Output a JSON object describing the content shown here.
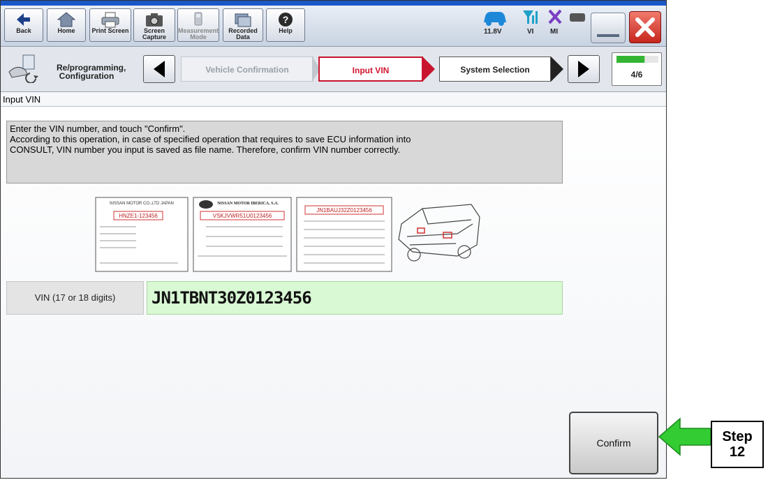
{
  "toolbar": {
    "buttons": [
      {
        "label": "Back",
        "icon": "back-arrow-icon"
      },
      {
        "label": "Home",
        "icon": "home-icon"
      },
      {
        "label": "Print Screen",
        "icon": "printer-icon"
      },
      {
        "label": "Screen Capture",
        "icon": "camera-icon"
      },
      {
        "label": "Measurement Mode",
        "icon": "meter-icon"
      },
      {
        "label": "Recorded Data",
        "icon": "recorded-data-icon"
      },
      {
        "label": "Help",
        "icon": "help-icon"
      }
    ],
    "status": {
      "voltage": "11.8V",
      "vi": "VI",
      "mi": "MI"
    }
  },
  "nav": {
    "section": "Re/programming, Configuration",
    "steps": [
      "Vehicle Confirmation",
      "Input VIN",
      "System Selection"
    ],
    "active_step": "Input VIN",
    "progress": "4/6",
    "progress_fraction": 0.67
  },
  "page_title": "Input VIN",
  "instructions": [
    "Enter the VIN number, and touch \"Confirm\".",
    "According to this operation, in case of specified operation that requires to save ECU information into",
    "CONSULT, VIN number you input is saved as file name. Therefore, confirm VIN number correctly."
  ],
  "plates": {
    "p1_header": "NISSAN MOTOR CO.,LTD JAPAN",
    "p1_vin": "HNZE1-123456",
    "p2_header": "NISSAN MOTOR IBERICA, S.A.",
    "p2_vin": "VSKJVWR51U0123456",
    "p3_vin": "JN1BAUJ32Z0123456"
  },
  "vin": {
    "label": "VIN (17 or 18 digits)",
    "value": "JN1TBNT30Z0123456"
  },
  "confirm_label": "Confirm",
  "callout": {
    "step": "Step",
    "number": "12"
  },
  "colors": {
    "accent_green": "#33cc33",
    "active_red": "#c8142c",
    "vin_field_bg": "#d9f8d4"
  }
}
